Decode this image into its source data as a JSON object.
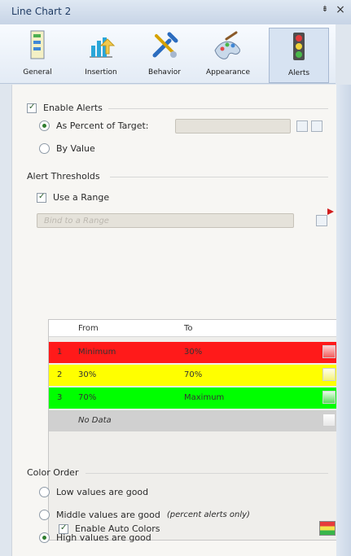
{
  "window": {
    "title": "Line Chart 2",
    "pin_glyph": "⇟",
    "close_glyph": "×"
  },
  "tabs": [
    {
      "label": "General",
      "icon": "general-icon"
    },
    {
      "label": "Insertion",
      "icon": "insertion-icon"
    },
    {
      "label": "Behavior",
      "icon": "behavior-icon"
    },
    {
      "label": "Appearance",
      "icon": "appearance-icon"
    },
    {
      "label": "Alerts",
      "icon": "alerts-icon",
      "active": true
    }
  ],
  "alerts": {
    "enable_alerts_label": "Enable Alerts",
    "as_percent_label": "As Percent of Target:",
    "by_value_label": "By Value",
    "target_placeholder": ""
  },
  "thresholds": {
    "section_label": "Alert Thresholds",
    "use_range_label": "Use a Range",
    "bind_range_placeholder": "Bind to a Range",
    "table_headers": {
      "from": "From",
      "to": "To"
    },
    "rows": [
      {
        "num": "1",
        "from": "Minimum",
        "to": "30%",
        "color": "#ff1a1a"
      },
      {
        "num": "2",
        "from": "30%",
        "to": "70%",
        "color": "#ffff00"
      },
      {
        "num": "3",
        "from": "70%",
        "to": "Maximum",
        "color": "#00ff00"
      }
    ],
    "no_data": "No Data",
    "enable_auto_colors_label": "Enable Auto Colors"
  },
  "color_order": {
    "section_label": "Color Order",
    "options": [
      {
        "label": "Low values are good",
        "selected": false
      },
      {
        "label": "Middle values are good",
        "note": "(percent alerts only)",
        "selected": false
      },
      {
        "label": "High values are good",
        "selected": true
      }
    ]
  },
  "colors": {
    "red": "#ff1a1a",
    "yellow": "#ffff00",
    "green": "#00ff00",
    "nodata": "#d0d0d0"
  }
}
